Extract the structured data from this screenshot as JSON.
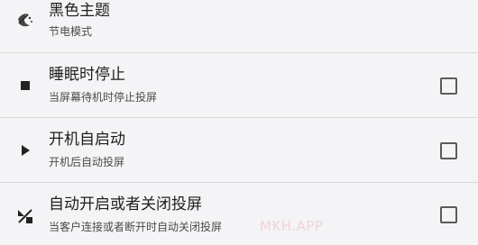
{
  "settings": [
    {
      "title": "黑色主题",
      "subtitle": "节电模式",
      "icon": "theme-night-icon",
      "has_checkbox": false
    },
    {
      "title": "睡眠时停止",
      "subtitle": "当屏幕待机时停止投屏",
      "icon": "stop-icon",
      "has_checkbox": true,
      "checked": false
    },
    {
      "title": "开机自启动",
      "subtitle": "开机后自动投屏",
      "icon": "play-icon",
      "has_checkbox": true,
      "checked": false
    },
    {
      "title": "自动开启或者关闭投屏",
      "subtitle": "当客户连接或者断开时自动关闭投屏",
      "icon": "toggle-cast-icon",
      "has_checkbox": true,
      "checked": false
    }
  ],
  "watermark": "MKH.APP",
  "colors": {
    "background": "#f4f4f6",
    "divider": "#d9d9dc",
    "checkbox_border": "#5b5b5b"
  }
}
